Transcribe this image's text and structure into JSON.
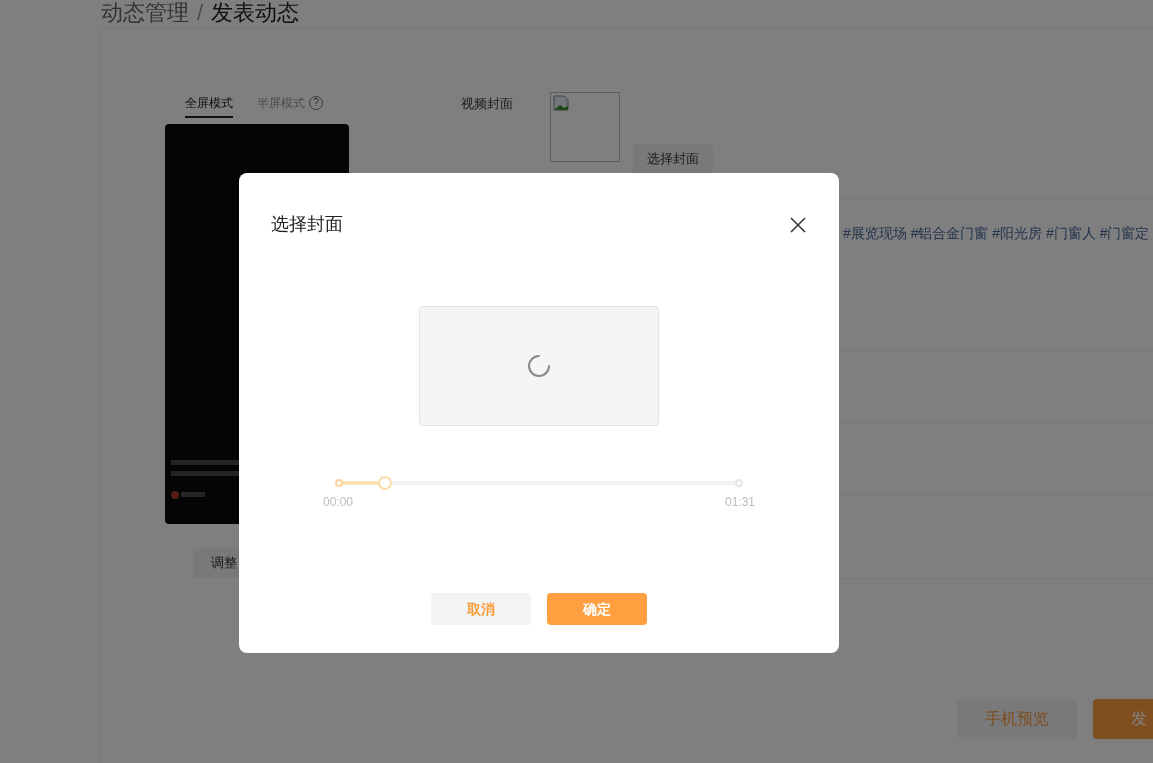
{
  "breadcrumb": {
    "parent": "动态管理",
    "separator": "/",
    "current": "发表动态"
  },
  "preview": {
    "tabs": [
      {
        "label": "全屏模式",
        "selected": true
      },
      {
        "label": "半屏模式",
        "selected": false,
        "help": "?"
      }
    ],
    "adjust_button": "调整"
  },
  "form": {
    "cover": {
      "label": "视频封面",
      "button": "选择封面"
    },
    "topics": "#展览现场 #铝合金门窗 #阳光房 #门窗人 #门窗定"
  },
  "actions": [
    {
      "label": "手机预览",
      "kind": "secondary"
    },
    {
      "label": "发",
      "kind": "primary"
    }
  ],
  "dialog": {
    "title": "选择封面",
    "loading": true,
    "slider": {
      "level": 0.115,
      "start": "00:00",
      "end": "01:31"
    },
    "buttons": [
      {
        "label": "取消",
        "kind": "secondary"
      },
      {
        "label": "确定",
        "kind": "primary"
      }
    ]
  }
}
